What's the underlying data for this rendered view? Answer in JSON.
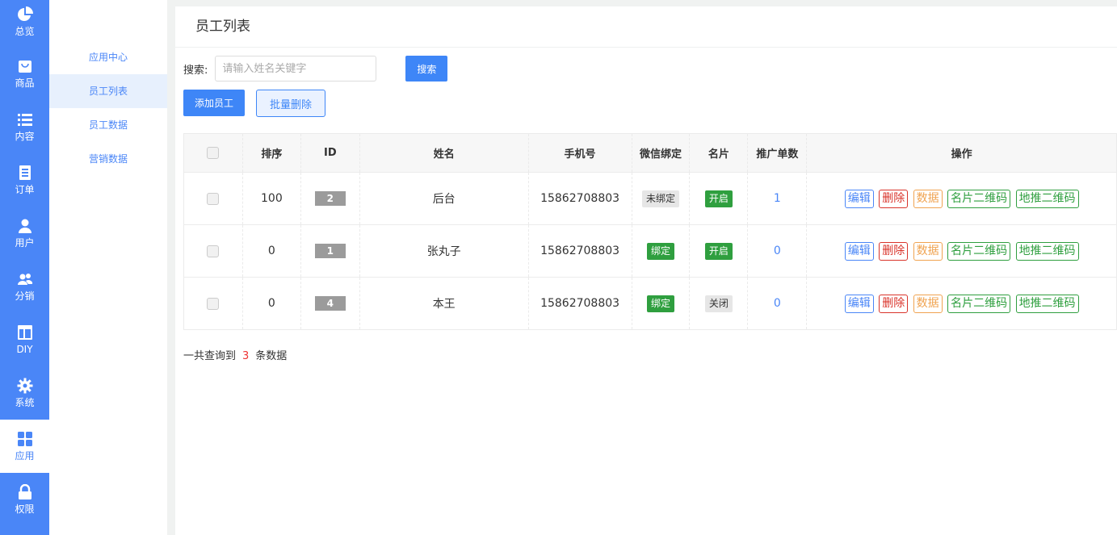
{
  "nav": [
    {
      "label": "总览",
      "icon": "pie-chart-icon"
    },
    {
      "label": "商品",
      "icon": "shopping-bag-icon"
    },
    {
      "label": "内容",
      "icon": "list-icon"
    },
    {
      "label": "订单",
      "icon": "document-icon"
    },
    {
      "label": "用户",
      "icon": "user-icon"
    },
    {
      "label": "分销",
      "icon": "users-icon"
    },
    {
      "label": "DIY",
      "icon": "layout-icon"
    },
    {
      "label": "系统",
      "icon": "gear-icon"
    },
    {
      "label": "应用",
      "icon": "grid-icon",
      "active": true
    },
    {
      "label": "权限",
      "icon": "lock-icon"
    }
  ],
  "submenu": [
    {
      "label": "应用中心"
    },
    {
      "label": "员工列表",
      "active": true
    },
    {
      "label": "员工数据"
    },
    {
      "label": "营销数据"
    }
  ],
  "page_title": "员工列表",
  "search": {
    "label": "搜索:",
    "placeholder": "请输入姓名关键字",
    "value": "",
    "button": "搜索"
  },
  "actions": {
    "add": "添加员工",
    "batch_delete": "批量删除"
  },
  "table": {
    "headers": [
      "排序",
      "ID",
      "姓名",
      "手机号",
      "微信绑定",
      "名片",
      "推广单数",
      "操作"
    ],
    "rows": [
      {
        "sort": "100",
        "id": "2",
        "name": "后台",
        "phone": "15862708803",
        "wechat": "未绑定",
        "card": "开启",
        "count": "1"
      },
      {
        "sort": "0",
        "id": "1",
        "name": "张丸子",
        "phone": "15862708803",
        "wechat": "绑定",
        "card": "开启",
        "count": "0"
      },
      {
        "sort": "0",
        "id": "4",
        "name": "本王",
        "phone": "15862708803",
        "wechat": "绑定",
        "card": "关闭",
        "count": "0"
      }
    ],
    "operations": [
      "编辑",
      "删除",
      "数据",
      "名片二维码",
      "地推二维码"
    ]
  },
  "summary": {
    "prefix": "一共查询到",
    "count": "3",
    "suffix": "条数据"
  },
  "colors": {
    "accent": "#4a86f7",
    "danger": "#d9342b",
    "warning": "#f0a350",
    "success": "#2f9f3f"
  }
}
